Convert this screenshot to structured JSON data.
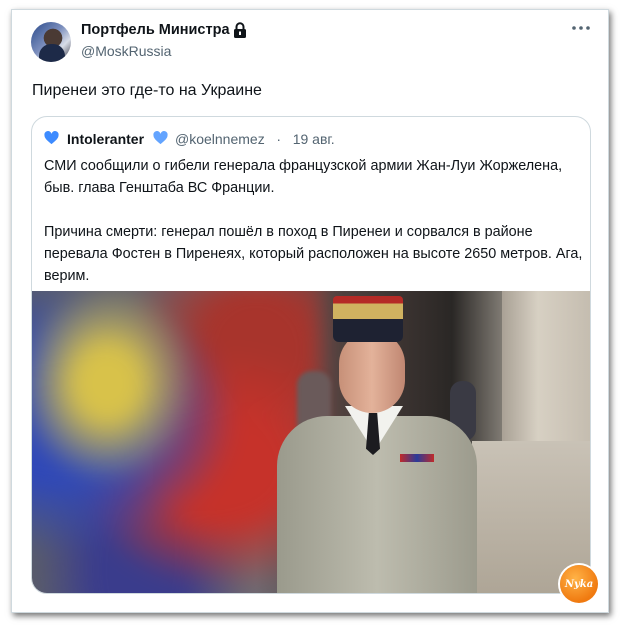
{
  "tweet": {
    "author": {
      "display_name": "Портфель Министра",
      "handle": "@MoskRussia",
      "avatar_icon": "avatar-image",
      "protected_icon": "lock-icon"
    },
    "more_icon": "more-horizontal-icon",
    "text": "Пиренеи это где-то на Украине"
  },
  "quote": {
    "author": {
      "display_name": "Intoleranter",
      "handle": "@koelnnemez",
      "separator": "·",
      "date": "19 авг."
    },
    "heart_color": "#3d8bff",
    "paragraphs": [
      "СМИ сообщили о гибели генерала французской армии Жан-Луи Жоржелена, быв. глава Генштаба ВС Франции.",
      "Причина смерти: генерал пошёл в поход в Пиренеи и сорвался в районе перевала Фостен в Пиренеях, который расположен на высоте 2650 метров. Ага, верим."
    ],
    "media": "photo-general-in-uniform"
  },
  "watermark": {
    "text": "Nyka",
    "color": "#f07a10"
  }
}
